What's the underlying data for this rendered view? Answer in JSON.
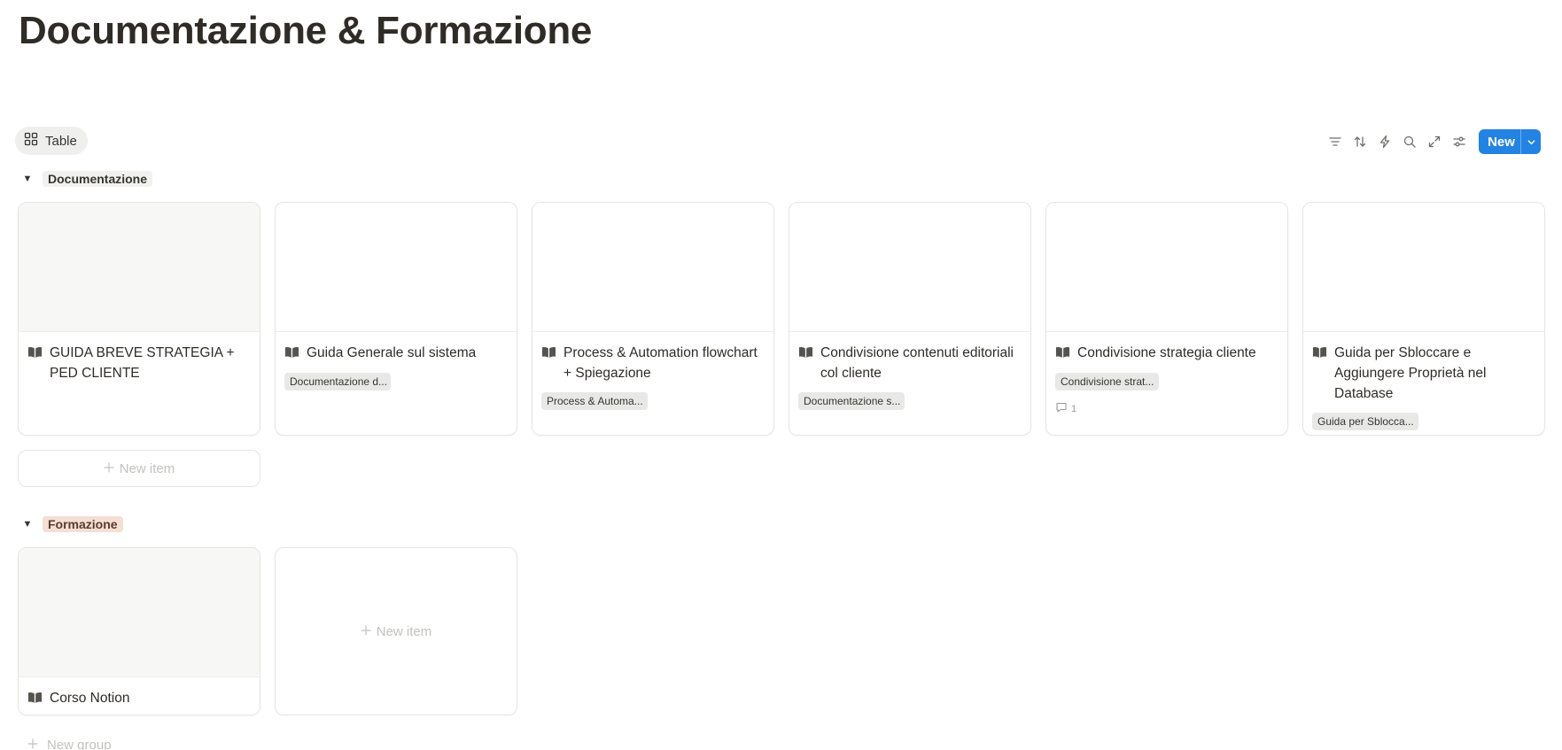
{
  "page": {
    "title": "Documentazione & Formazione"
  },
  "view": {
    "tab_label": "Table",
    "tab_icon": "gallery-grid-icon"
  },
  "toolbar": {
    "icons": [
      "filter-icon",
      "sort-icon",
      "lightning-icon",
      "search-icon",
      "expand-icon",
      "settings-sliders-icon"
    ],
    "new_label": "New",
    "accent": "#2383e2"
  },
  "groups": [
    {
      "label": "Documentazione",
      "color": "#f1f1ef",
      "cards": [
        {
          "title": "GUIDA BREVE STRATEGIA + PED CLIENTE",
          "tag": "",
          "comments": ""
        },
        {
          "title": "Guida Generale sul sistema",
          "tag": "Documentazione d...",
          "comments": ""
        },
        {
          "title": "Process & Automation flowchart + Spiegazione",
          "tag": "Process & Automa...",
          "comments": ""
        },
        {
          "title": "Condivisione contenuti editoriali col cliente",
          "tag": "Documentazione s...",
          "comments": ""
        },
        {
          "title": "Condivisione strategia cliente",
          "tag": "Condivisione strat...",
          "comments": "1"
        },
        {
          "title": "Guida per Sbloccare e Aggiungere Proprietà nel Database",
          "tag": "Guida per Sblocca...",
          "comments": ""
        }
      ],
      "new_item_label": "New item"
    },
    {
      "label": "Formazione",
      "color": "#f4dfd3",
      "cards": [
        {
          "title": "Corso Notion",
          "tag": "",
          "comments": ""
        }
      ],
      "new_item_label": "New item"
    }
  ],
  "new_group_label": "New group",
  "card_icon": "book-open-icon"
}
